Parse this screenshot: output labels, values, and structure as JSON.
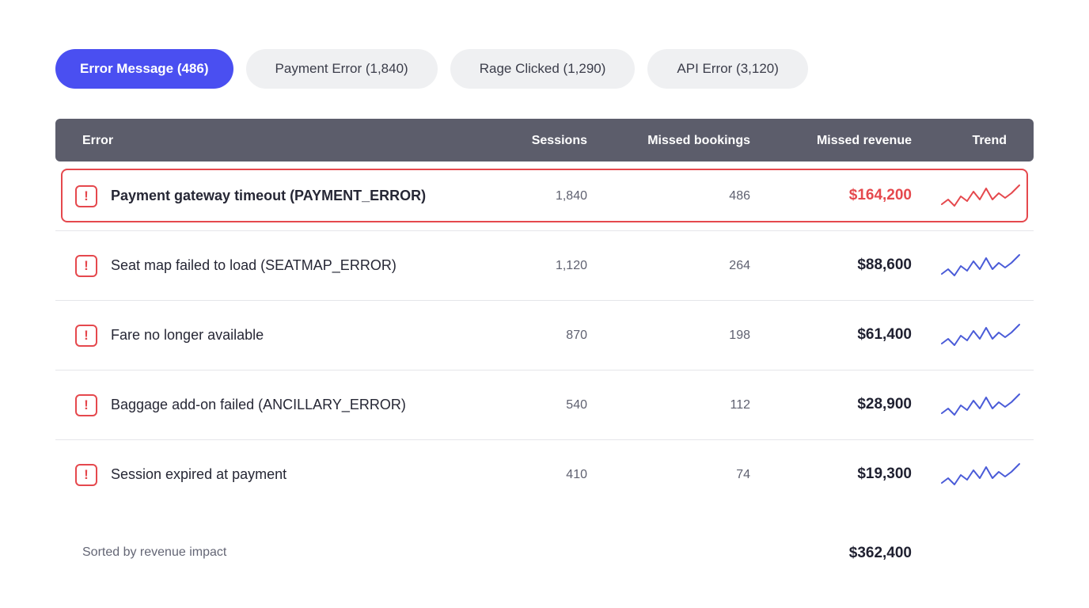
{
  "filters": [
    {
      "label": "Error Message (486)",
      "active": true
    },
    {
      "label": "Payment Error (1,840)",
      "active": false
    },
    {
      "label": "Rage Clicked (1,290)",
      "active": false
    },
    {
      "label": "API Error (3,120)",
      "active": false
    }
  ],
  "table": {
    "headers": {
      "error": "Error",
      "sessions": "Sessions",
      "bookings": "Missed bookings",
      "revenue": "Missed revenue",
      "trend": "Trend"
    },
    "rows": [
      {
        "icon": "!",
        "label": "Payment gateway timeout (PAYMENT_ERROR)",
        "sessions": "1,840",
        "bookings": "486",
        "revenue": "$164,200",
        "highlighted": true,
        "trend_color": "#e5484d"
      },
      {
        "icon": "!",
        "label": "Seat map failed to load (SEATMAP_ERROR)",
        "sessions": "1,120",
        "bookings": "264",
        "revenue": "$88,600",
        "highlighted": false,
        "trend_color": "#4a5bd8"
      },
      {
        "icon": "!",
        "label": "Fare no longer available",
        "sessions": "870",
        "bookings": "198",
        "revenue": "$61,400",
        "highlighted": false,
        "trend_color": "#4a5bd8"
      },
      {
        "icon": "!",
        "label": "Baggage add-on failed (ANCILLARY_ERROR)",
        "sessions": "540",
        "bookings": "112",
        "revenue": "$28,900",
        "highlighted": false,
        "trend_color": "#4a5bd8"
      },
      {
        "icon": "!",
        "label": "Session expired at payment",
        "sessions": "410",
        "bookings": "74",
        "revenue": "$19,300",
        "highlighted": false,
        "trend_color": "#4a5bd8"
      }
    ],
    "trend_icon": "sparkline-icon"
  },
  "footer": {
    "note": "Sorted by revenue impact",
    "total": "$362,400"
  },
  "colors": {
    "accent": "#4a4ff1",
    "danger": "#e5484d",
    "header_bg": "#5c5d6b",
    "trend_blue": "#4a5bd8"
  }
}
